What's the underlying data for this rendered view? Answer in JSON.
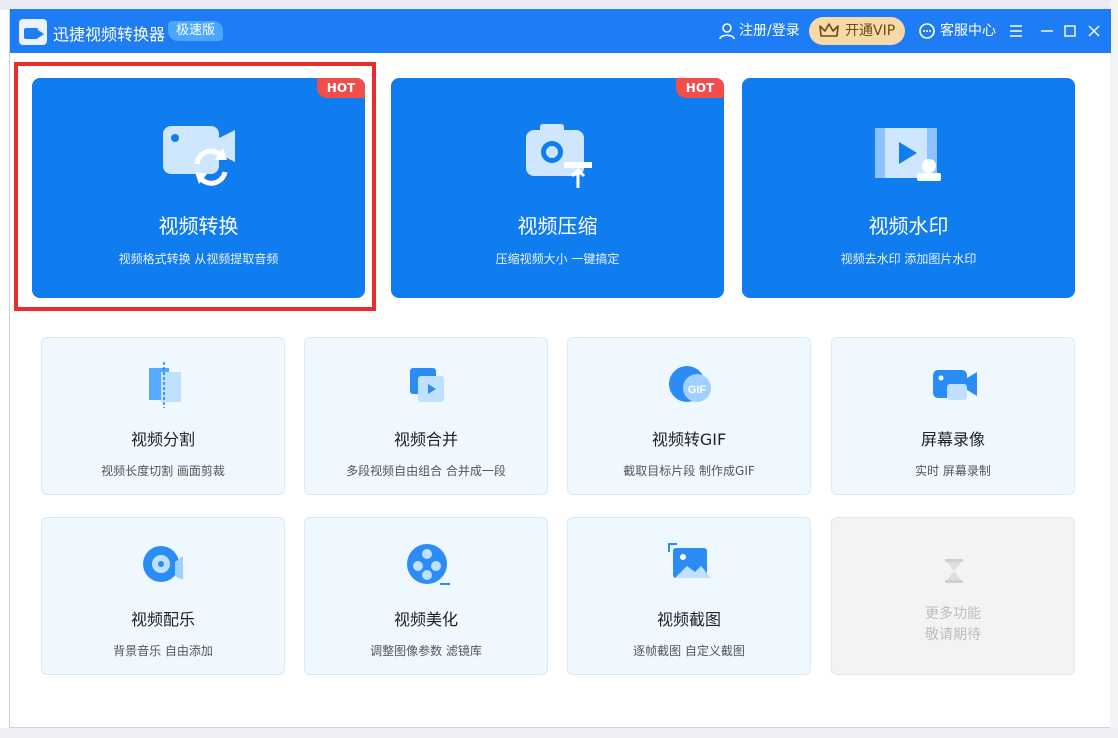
{
  "app": {
    "title": "迅捷视频转换器",
    "badge": "极速版",
    "login": "注册/登录",
    "vip": "开通VIP",
    "service": "客服中心"
  },
  "featured": [
    {
      "title": "视频转换",
      "subtitle": "视频格式转换 从视频提取音频",
      "hot": "HOT",
      "icon": "video-convert-icon"
    },
    {
      "title": "视频压缩",
      "subtitle": "压缩视频大小 一键搞定",
      "hot": "HOT",
      "icon": "video-compress-icon"
    },
    {
      "title": "视频水印",
      "subtitle": "视频去水印 添加图片水印",
      "hot": "",
      "icon": "video-watermark-icon"
    }
  ],
  "tools": [
    {
      "title": "视频分割",
      "subtitle": "视频长度切割 画面剪裁",
      "icon": "video-split-icon"
    },
    {
      "title": "视频合并",
      "subtitle": "多段视频自由组合 合并成一段",
      "icon": "video-merge-icon"
    },
    {
      "title": "视频转GIF",
      "subtitle": "截取目标片段 制作成GIF",
      "icon": "gif-icon"
    },
    {
      "title": "屏幕录像",
      "subtitle": "实时 屏幕录制",
      "icon": "screen-record-icon"
    },
    {
      "title": "视频配乐",
      "subtitle": "背景音乐 自由添加",
      "icon": "music-icon"
    },
    {
      "title": "视频美化",
      "subtitle": "调整图像参数 滤镜库",
      "icon": "beautify-icon"
    },
    {
      "title": "视频截图",
      "subtitle": "逐帧截图 自定义截图",
      "icon": "screenshot-icon"
    }
  ],
  "more": {
    "line1": "更多功能",
    "line2": "敬请期待",
    "icon": "hourglass-icon"
  },
  "colors": {
    "primary": "#1e7df5",
    "card": "#0f7cf0",
    "hot": "#f14d4d",
    "highlight": "#ec2b2b",
    "vip": "#f6d9a6"
  }
}
